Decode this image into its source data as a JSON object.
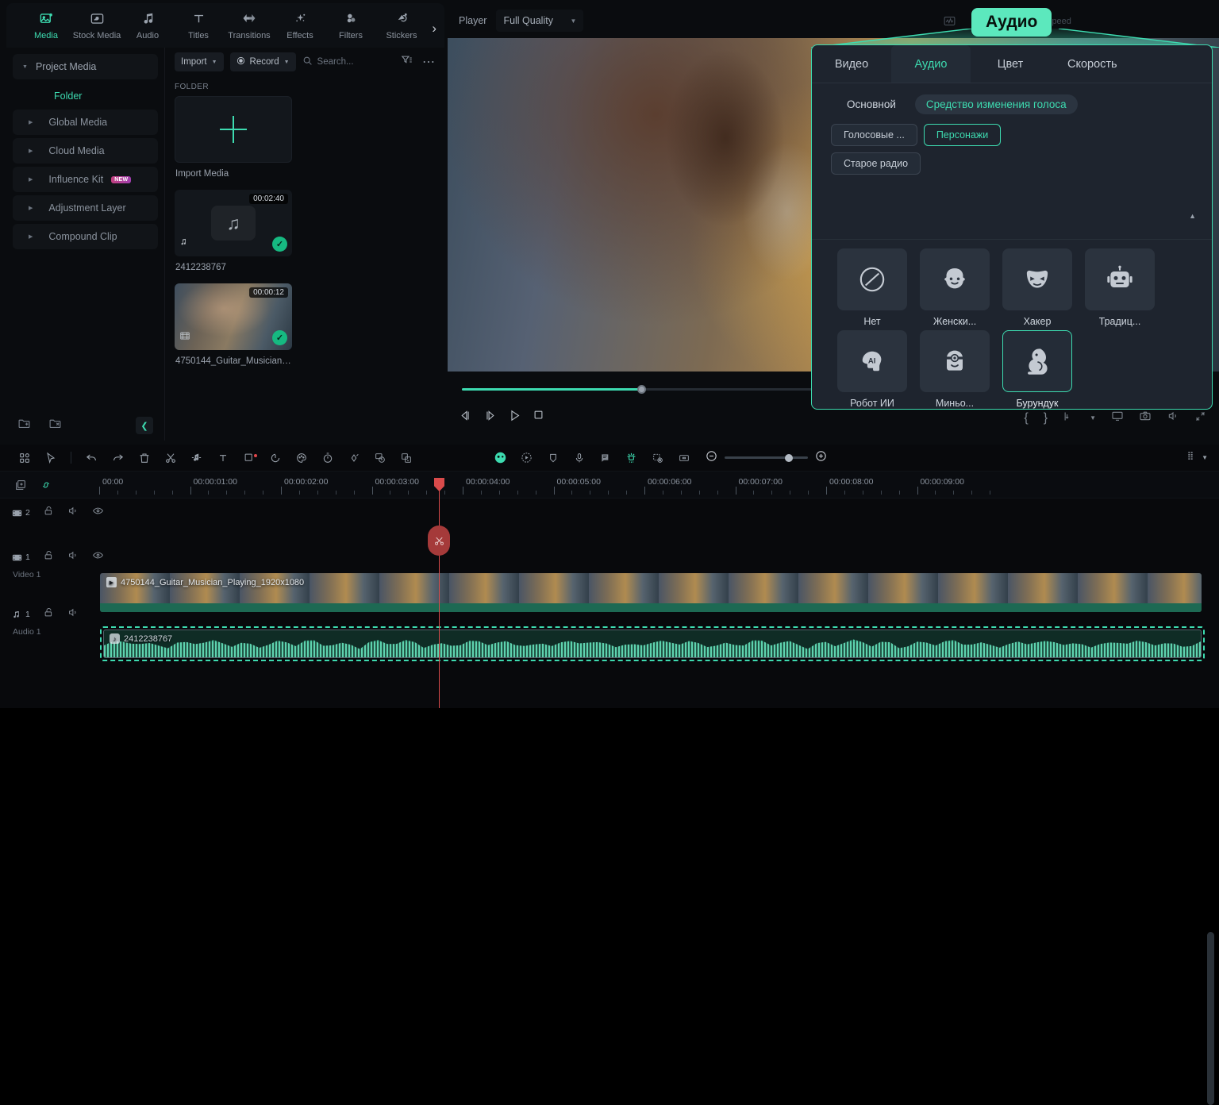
{
  "topnav": {
    "items": [
      {
        "label": "Media",
        "icon": "media-icon",
        "active": true
      },
      {
        "label": "Stock Media",
        "icon": "stock-media-icon",
        "active": false
      },
      {
        "label": "Audio",
        "icon": "audio-note-icon",
        "active": false
      },
      {
        "label": "Titles",
        "icon": "titles-text-icon",
        "active": false
      },
      {
        "label": "Transitions",
        "icon": "transitions-icon",
        "active": false
      },
      {
        "label": "Effects",
        "icon": "effects-sparkle-icon",
        "active": false
      },
      {
        "label": "Filters",
        "icon": "filters-circles-icon",
        "active": false
      },
      {
        "label": "Stickers",
        "icon": "stickers-icon",
        "active": false
      }
    ],
    "more": "›"
  },
  "sidebar": {
    "project_media": "Project Media",
    "folder": "Folder",
    "items": [
      {
        "label": "Global Media",
        "badge": null
      },
      {
        "label": "Cloud Media",
        "badge": null
      },
      {
        "label": "Influence Kit",
        "badge": "NEW"
      },
      {
        "label": "Adjustment Layer",
        "badge": null
      },
      {
        "label": "Compound Clip",
        "badge": null
      }
    ]
  },
  "media": {
    "import_label": "Import",
    "record_label": "Record",
    "search_placeholder": "Search...",
    "section_caption": "FOLDER",
    "import_tile_label": "Import Media",
    "items": [
      {
        "name": "2412238767",
        "duration": "00:02:40",
        "type": "audio",
        "checked": true
      },
      {
        "name": "4750144_Guitar_Musician_Pl...",
        "duration": "00:00:12",
        "type": "video",
        "checked": true
      }
    ]
  },
  "player": {
    "label": "Player",
    "quality": "Full Quality",
    "progress_percent": 24
  },
  "timeline": {
    "ruler_labels": [
      "00:00",
      "00:00:01:00",
      "00:00:02:00",
      "00:00:03:00",
      "00:00:04:00",
      "00:00:05:00",
      "00:00:06:00",
      "00:00:07:00",
      "00:00:08:00",
      "00:00:09:00"
    ],
    "tracks": [
      {
        "kind": "video",
        "number": "2",
        "name": ""
      },
      {
        "kind": "video",
        "number": "1",
        "name": "Video 1"
      },
      {
        "kind": "audio",
        "number": "1",
        "name": "Audio 1"
      }
    ],
    "video_clip": "4750144_Guitar_Musician_Playing_1920x1080",
    "audio_clip": "2412238767",
    "zoom_percent": 72
  },
  "callout": {
    "text": "Аудио"
  },
  "audio_panel": {
    "tabs": [
      {
        "label": "Видео",
        "active": false
      },
      {
        "label": "Аудио",
        "active": true
      },
      {
        "label": "Цвет",
        "active": false
      },
      {
        "label": "Скорость",
        "active": false
      }
    ],
    "subtabs": [
      {
        "label": "Основной",
        "active": false
      },
      {
        "label": "Средство изменения голоса",
        "active": true
      }
    ],
    "chips": [
      {
        "label": "Голосовые ...",
        "selected": false
      },
      {
        "label": "Персонажи",
        "selected": true
      },
      {
        "label": "Старое радио",
        "selected": false
      }
    ],
    "characters": [
      {
        "label": "Нет",
        "icon": "none-slash-icon",
        "selected": false
      },
      {
        "label": "Женски...",
        "icon": "female-face-icon",
        "selected": false
      },
      {
        "label": "Хакер",
        "icon": "hacker-mask-icon",
        "selected": false
      },
      {
        "label": "Традиц...",
        "icon": "robot-head-icon",
        "selected": false
      },
      {
        "label": "Робот ИИ",
        "icon": "ai-head-icon",
        "selected": false
      },
      {
        "label": "Миньо...",
        "icon": "minion-icon",
        "selected": false
      },
      {
        "label": "Бурундук",
        "icon": "squirrel-icon",
        "selected": true
      }
    ]
  },
  "ghost": {
    "speed": "Speed",
    "ai": "AI"
  },
  "colors": {
    "accent": "#3ddbb0",
    "callout_bg": "#5ce8bd",
    "panel_bg": "#1e242e",
    "playhead": "#d94b4b"
  }
}
